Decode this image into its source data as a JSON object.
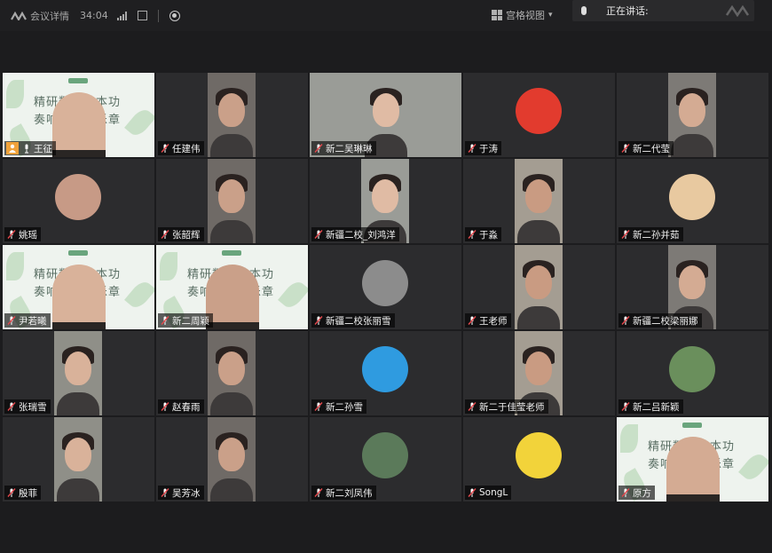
{
  "topbar": {
    "title": "会议详情",
    "timer": "34:04",
    "view_label": "宫格视图"
  },
  "speaking_banner": {
    "label": "正在讲话:"
  },
  "poster": {
    "line1": "精研数学基本功",
    "line2": "奏响教研新乐章"
  },
  "participants": [
    {
      "name": "王征",
      "kind": "poster",
      "host": true
    },
    {
      "name": "任建伟",
      "kind": "person"
    },
    {
      "name": "新二吴琳琳",
      "kind": "wide"
    },
    {
      "name": "于涛",
      "kind": "avatar",
      "color": "#e23b2e"
    },
    {
      "name": "新二代莹",
      "kind": "person"
    },
    {
      "name": "姚瑶",
      "kind": "avatar",
      "color": "#c79a86"
    },
    {
      "name": "张韶辉",
      "kind": "person"
    },
    {
      "name": "新疆二校_刘鸿洋",
      "kind": "person"
    },
    {
      "name": "于淼",
      "kind": "person"
    },
    {
      "name": "新二孙并茹",
      "kind": "avatar",
      "color": "#e8c9a0"
    },
    {
      "name": "尹若曦",
      "kind": "poster"
    },
    {
      "name": "新二周颖",
      "kind": "poster"
    },
    {
      "name": "新疆二校张丽雪",
      "kind": "avatar",
      "color": "#8c8c8c"
    },
    {
      "name": "王老师",
      "kind": "person"
    },
    {
      "name": "新疆二校梁丽娜",
      "kind": "person"
    },
    {
      "name": "张瑞雪",
      "kind": "person"
    },
    {
      "name": "赵春雨",
      "kind": "person"
    },
    {
      "name": "新二孙雪",
      "kind": "avatar",
      "color": "#2f9be0"
    },
    {
      "name": "新二于佳莹老师",
      "kind": "person"
    },
    {
      "name": "新二吕新颖",
      "kind": "avatar",
      "color": "#6a8f5c"
    },
    {
      "name": "殷菲",
      "kind": "person"
    },
    {
      "name": "吴芳冰",
      "kind": "person"
    },
    {
      "name": "新二刘凤伟",
      "kind": "avatar",
      "color": "#5b7a5a"
    },
    {
      "name": "SongL",
      "kind": "avatar",
      "color": "#f2d33a"
    },
    {
      "name": "原方",
      "kind": "poster"
    }
  ]
}
